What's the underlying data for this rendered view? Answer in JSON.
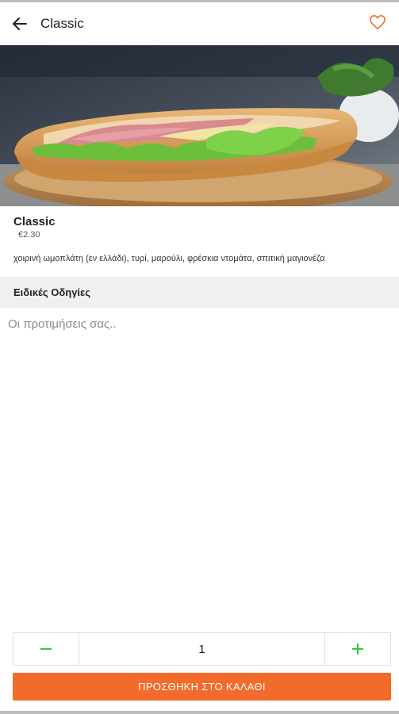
{
  "header": {
    "title": "Classic",
    "back_icon": "arrow-left-icon",
    "favorite_icon": "heart-outline-icon"
  },
  "product": {
    "name": "Classic",
    "price": "€2.30",
    "description": "χοιρινή ωμοπλάτη (εν ελλάδι), τυρί, μαρούλι, φρέσκια ντομάτα, σπιτική μαγιονέζα",
    "image": "sandwich-photo"
  },
  "instructions": {
    "heading": "Ειδικές Οδηγίες",
    "placeholder": "Οι προτιμήσεις σας..",
    "value": ""
  },
  "quantity": {
    "value": "1",
    "minus_icon": "minus-icon",
    "plus_icon": "plus-icon"
  },
  "cart": {
    "add_label": "ΠΡΟΣΘΗΚΗ ΣΤΟ ΚΑΛΑΘΙ"
  },
  "colors": {
    "accent": "#f26b2b",
    "stepper_icon": "#2ecc40",
    "section_bg": "#f0f0f0"
  }
}
